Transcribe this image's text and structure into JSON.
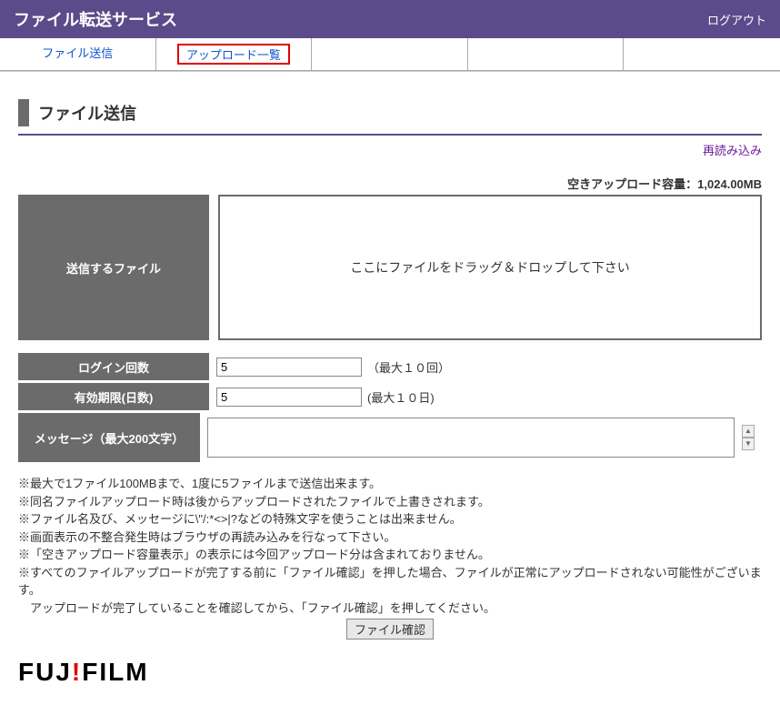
{
  "header": {
    "title": "ファイル転送サービス",
    "logout": "ログアウト"
  },
  "tabs": {
    "t1": "ファイル送信",
    "t2": "アップロード一覧"
  },
  "section": {
    "title": "ファイル送信",
    "reload": "再読み込み",
    "capacity": "空きアップロード容量：1,024.00MB"
  },
  "form": {
    "file_label": "送信するファイル",
    "dropzone_text": "ここにファイルをドラッグ＆ドロップして下さい",
    "login_label": "ログイン回数",
    "login_value": "5",
    "login_hint": "（最大１０回）",
    "expire_label": "有効期限(日数)",
    "expire_value": "5",
    "expire_hint": "(最大１０日)",
    "message_label": "メッセージ（最大200文字）"
  },
  "notes": {
    "n1": "※最大で1ファイル100MBまで、1度に5ファイルまで送信出来ます。",
    "n2": "※同名ファイルアップロード時は後からアップロードされたファイルで上書きされます。",
    "n3": "※ファイル名及び、メッセージに\\\"/:*<>|?などの特殊文字を使うことは出来ません。",
    "n4": "※画面表示の不整合発生時はブラウザの再読み込みを行なって下さい。",
    "n5": "※「空きアップロード容量表示」の表示には今回アップロード分は含まれておりません。",
    "n6": "※すべてのファイルアップロードが完了する前に「ファイル確認」を押した場合、ファイルが正常にアップロードされない可能性がございます。",
    "n7": "　アップロードが完了していることを確認してから、「ファイル確認」を押してください。"
  },
  "confirm_button": "ファイル確認",
  "logo": {
    "p1": "FUJ",
    "dot": "!",
    "p2": "FILM"
  }
}
